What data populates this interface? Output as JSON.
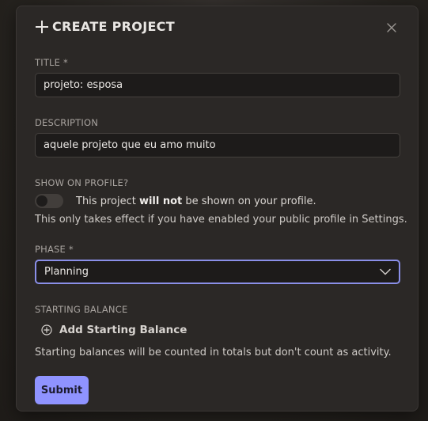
{
  "modal": {
    "title": "CREATE PROJECT",
    "close_icon": "close-icon"
  },
  "fields": {
    "title": {
      "label": "TITLE *",
      "value": "projeto: esposa"
    },
    "description": {
      "label": "DESCRIPTION",
      "value": "aquele projeto que eu amo muito"
    },
    "show_on_profile": {
      "label": "SHOW ON PROFILE?",
      "enabled": false,
      "text_before": "This project ",
      "text_strong": "will not",
      "text_after": " be shown on your profile.",
      "note": "This only takes effect if you have enabled your public profile in Settings."
    },
    "phase": {
      "label": "PHASE *",
      "selected": "Planning"
    },
    "starting_balance": {
      "label": "STARTING BALANCE",
      "add_label": "Add Starting Balance",
      "note": "Starting balances will be counted in totals but don't count as activity."
    }
  },
  "actions": {
    "submit_label": "Submit"
  },
  "colors": {
    "accent": "#8f93ff",
    "focus_border": "#8a8fe8",
    "modal_bg": "#2b2826",
    "input_bg": "#1d1b1a"
  }
}
